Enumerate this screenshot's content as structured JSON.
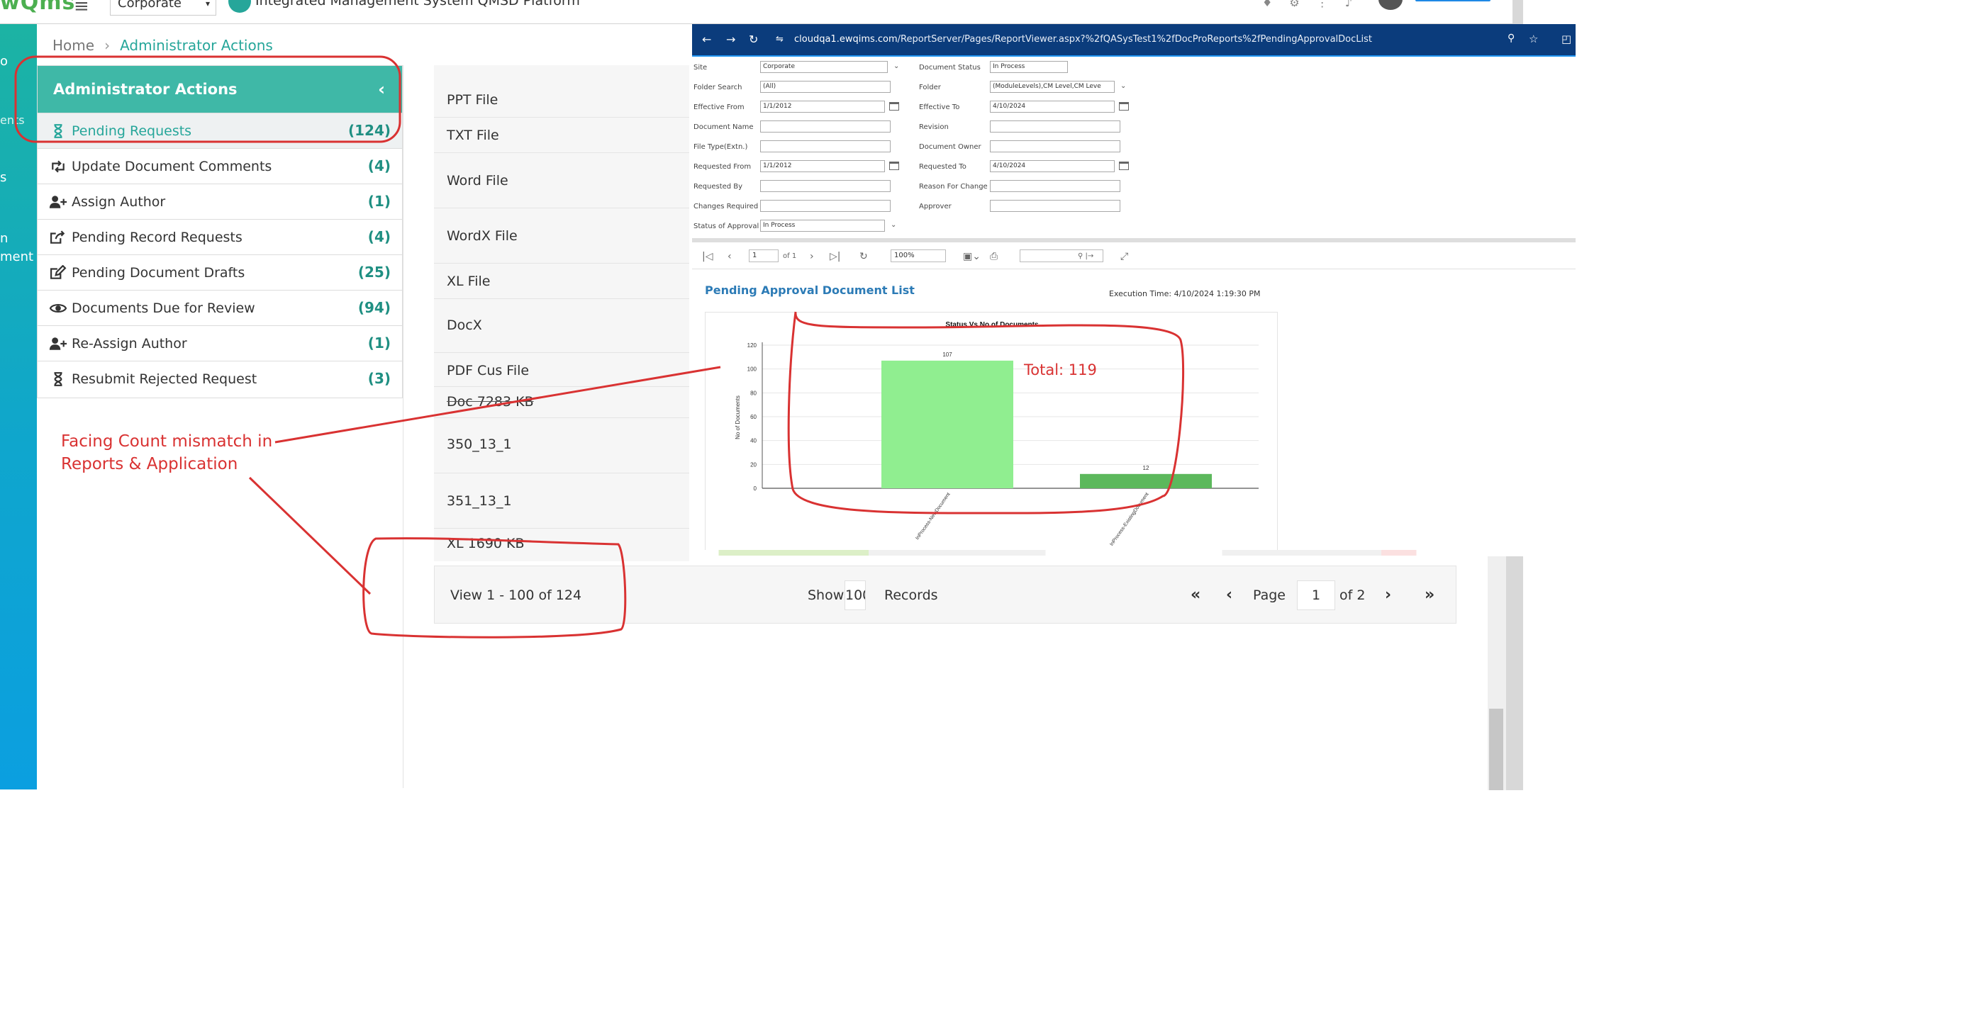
{
  "topbar": {
    "logo": "wQms",
    "company_select": "Corporate",
    "title": "Integrated Management System QMSD Platform"
  },
  "rail": {
    "items": [
      "o",
      "ents",
      "s",
      "n",
      "ment"
    ]
  },
  "breadcrumb": {
    "home": "Home",
    "current": "Administrator Actions"
  },
  "admin_panel": {
    "title": "Administrator Actions",
    "items": [
      {
        "label": "Pending Requests",
        "count": "(124)",
        "icon": "hourglass-icon",
        "active": true
      },
      {
        "label": "Update Document Comments",
        "count": "(4)",
        "icon": "retweet-icon"
      },
      {
        "label": "Assign Author",
        "count": "(1)",
        "icon": "user-plus-icon"
      },
      {
        "label": "Pending Record Requests",
        "count": "(4)",
        "icon": "share-square-icon"
      },
      {
        "label": "Pending Document Drafts",
        "count": "(25)",
        "icon": "edit-icon"
      },
      {
        "label": "Documents Due for Review",
        "count": "(94)",
        "icon": "eye-icon"
      },
      {
        "label": "Re-Assign Author",
        "count": "(1)",
        "icon": "user-plus-icon"
      },
      {
        "label": "Resubmit Rejected Request",
        "count": "(3)",
        "icon": "hourglass-icon"
      }
    ]
  },
  "file_list": {
    "items": [
      "PPT File",
      "TXT File",
      "Word File",
      "WordX File",
      "XL File",
      "DocX",
      "PDF Cus File",
      "Doc 7283 KB",
      "350_13_1",
      "351_13_1",
      "XL 1690 KB"
    ]
  },
  "pager": {
    "summary": "View 1 - 100 of 124",
    "show_label": "Show",
    "show_value": "100",
    "records_label": "Records",
    "page_label": "Page",
    "page_value": "1",
    "of_label": "of 2"
  },
  "browser": {
    "url_host": "cloudqa1.ewqims.com",
    "url_path": "/ReportServer/Pages/ReportViewer.aspx?%2fQASysTest1%2fDocProReports%2fPendingApprovalDocList",
    "params": {
      "site_label": "Site",
      "site_value": "Corporate",
      "doc_status_label": "Document Status",
      "doc_status_value": "In Process",
      "folder_search_label": "Folder Search",
      "folder_search_value": "(All)",
      "folder_label": "Folder",
      "folder_value": "(ModuleLevels),CM Level,CM Leve",
      "eff_from_label": "Effective From",
      "eff_from_value": "1/1/2012",
      "eff_to_label": "Effective To",
      "eff_to_value": "4/10/2024",
      "doc_name_label": "Document Name",
      "revision_label": "Revision",
      "file_type_label": "File Type(Extn.)",
      "doc_owner_label": "Document Owner",
      "req_from_label": "Requested From",
      "req_from_value": "1/1/2012",
      "req_to_label": "Requested To",
      "req_to_value": "4/10/2024",
      "req_by_label": "Requested By",
      "reason_label": "Reason For Change",
      "changes_label": "Changes Required",
      "approver_label": "Approver",
      "status_approval_label": "Status of Approval",
      "status_approval_value": "In Process"
    },
    "toolbar": {
      "page_value": "1",
      "of_pages": "of 1",
      "zoom_value": "100%"
    },
    "report_title": "Pending Approval Document List",
    "execution_time": "Execution Time: 4/10/2024 1:19:30 PM"
  },
  "chart_data": {
    "type": "bar",
    "title": "Status Vs No of Documents",
    "ylabel": "No of Documents",
    "xlabel": "",
    "categories": [
      "InProcess-NewDocument",
      "InProcess-ExistingDocument"
    ],
    "values": [
      107,
      12
    ],
    "data_labels": [
      "107",
      "12"
    ],
    "ylim": [
      0,
      120
    ],
    "yticks": [
      0,
      20,
      40,
      60,
      80,
      100,
      120
    ],
    "grid": true,
    "colors": [
      "#90ee90",
      "#5cb85c"
    ]
  },
  "annotations": {
    "total_text": "Total: 119",
    "mismatch_line1": "Facing Count mismatch in",
    "mismatch_line2": "Reports & Application",
    "color": "#d93232"
  }
}
